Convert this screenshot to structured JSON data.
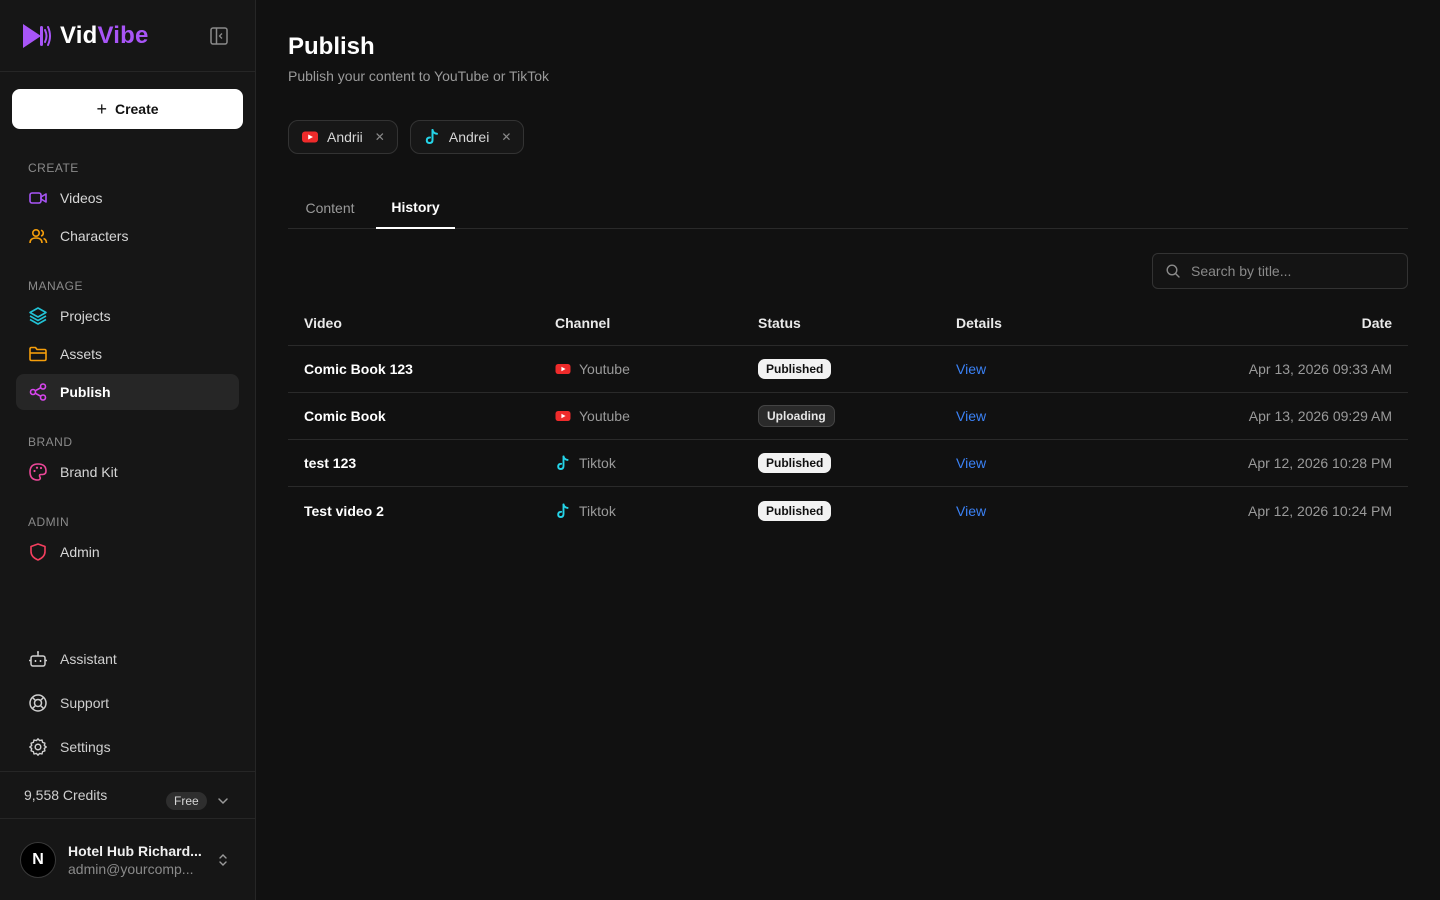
{
  "brand": {
    "name_a": "Vid",
    "name_b": "Vibe",
    "accent": "#a855f7"
  },
  "sidebar": {
    "create_label": "Create",
    "sections": [
      {
        "label": "CREATE",
        "items": [
          {
            "label": "Videos",
            "icon": "video-icon"
          },
          {
            "label": "Characters",
            "icon": "users-icon"
          }
        ]
      },
      {
        "label": "MANAGE",
        "items": [
          {
            "label": "Projects",
            "icon": "layers-icon"
          },
          {
            "label": "Assets",
            "icon": "folder-icon"
          },
          {
            "label": "Publish",
            "icon": "share-icon",
            "active": true
          }
        ]
      },
      {
        "label": "BRAND",
        "items": [
          {
            "label": "Brand Kit",
            "icon": "palette-icon"
          }
        ]
      },
      {
        "label": "ADMIN",
        "items": [
          {
            "label": "Admin",
            "icon": "shield-icon"
          }
        ]
      }
    ],
    "bottom_items": [
      {
        "label": "Assistant",
        "icon": "bot-icon"
      },
      {
        "label": "Support",
        "icon": "lifebuoy-icon"
      },
      {
        "label": "Settings",
        "icon": "gear-icon"
      }
    ],
    "credits": {
      "text": "9,558 Credits",
      "plan": "Free"
    },
    "user": {
      "initial": "N",
      "name": "Hotel Hub Richard...",
      "email": "admin@yourcomp..."
    }
  },
  "main": {
    "title": "Publish",
    "subtitle": "Publish your content to YouTube or TikTok",
    "chips": [
      {
        "label": "Andrii",
        "platform": "youtube"
      },
      {
        "label": "Andrei",
        "platform": "tiktok"
      }
    ],
    "tabs": [
      {
        "label": "Content"
      },
      {
        "label": "History",
        "active": true
      }
    ],
    "search": {
      "placeholder": "Search by title..."
    },
    "table": {
      "headers": {
        "video": "Video",
        "channel": "Channel",
        "status": "Status",
        "details": "Details",
        "date": "Date"
      },
      "rows": [
        {
          "title": "Comic Book 123",
          "channel": "Youtube",
          "platform": "youtube",
          "status": "Published",
          "details": "View",
          "date": "Apr 13, 2026 09:33 AM"
        },
        {
          "title": "Comic Book",
          "channel": "Youtube",
          "platform": "youtube",
          "status": "Uploading",
          "details": "View",
          "date": "Apr 13, 2026 09:29 AM"
        },
        {
          "title": "test 123",
          "channel": "Tiktok",
          "platform": "tiktok",
          "status": "Published",
          "details": "View",
          "date": "Apr 12, 2026 10:28 PM"
        },
        {
          "title": "Test video 2",
          "channel": "Tiktok",
          "platform": "tiktok",
          "status": "Published",
          "details": "View",
          "date": "Apr 12, 2026 10:24 PM"
        }
      ]
    }
  },
  "colors": {
    "youtube": "#ef2b2b",
    "tiktok": "#25d4e8",
    "link": "#3b82f6"
  }
}
